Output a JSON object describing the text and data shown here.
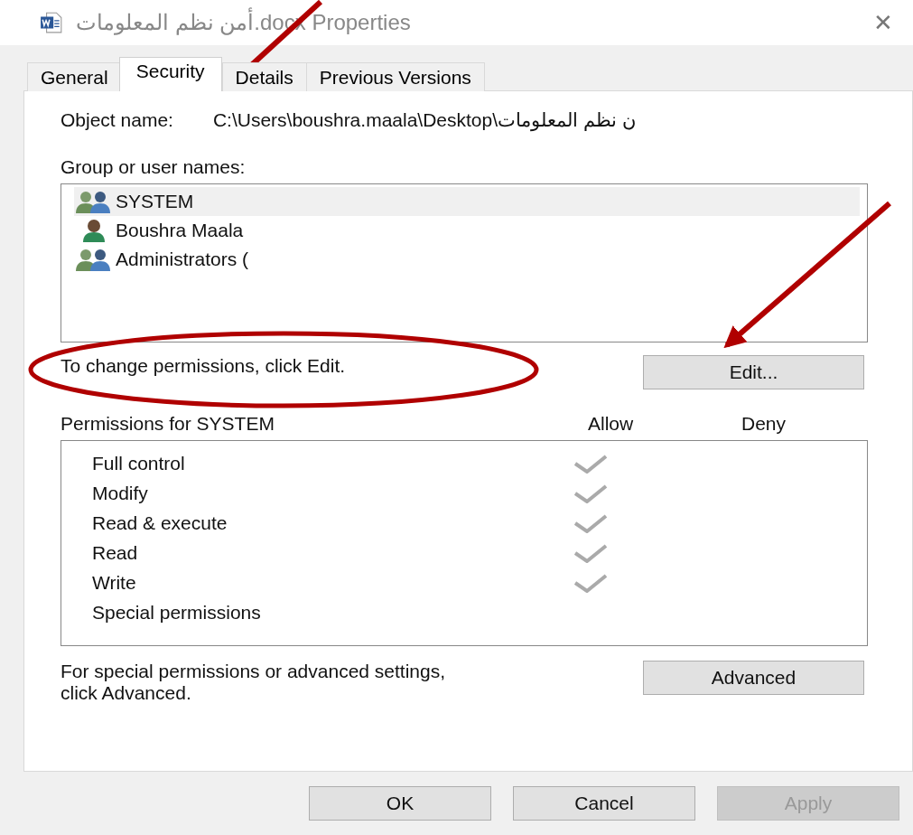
{
  "window": {
    "title": "أمن نظم المعلومات.docx Properties",
    "close": "✕"
  },
  "tabs": [
    {
      "label": "General",
      "selected": false
    },
    {
      "label": "Security",
      "selected": true
    },
    {
      "label": "Details",
      "selected": false
    },
    {
      "label": "Previous Versions",
      "selected": false
    }
  ],
  "object_name": {
    "label": "Object name:",
    "value": "C:\\Users\\boushra.maala\\Desktop\\ن نظم المعلومات"
  },
  "users": {
    "label": "Group or user names:",
    "items": [
      {
        "name": "SYSTEM",
        "kind": "group",
        "selected": true
      },
      {
        "name": "Boushra Maala",
        "kind": "user",
        "selected": false
      },
      {
        "name": "Administrators (",
        "kind": "group",
        "selected": false
      }
    ]
  },
  "change_hint": "To change permissions, click Edit.",
  "edit_button": "Edit...",
  "permissions": {
    "label": "Permissions for SYSTEM",
    "allow_label": "Allow",
    "deny_label": "Deny",
    "items": [
      {
        "name": "Full control",
        "allow": true,
        "deny": false
      },
      {
        "name": "Modify",
        "allow": true,
        "deny": false
      },
      {
        "name": "Read & execute",
        "allow": true,
        "deny": false
      },
      {
        "name": "Read",
        "allow": true,
        "deny": false
      },
      {
        "name": "Write",
        "allow": true,
        "deny": false
      },
      {
        "name": "Special permissions",
        "allow": false,
        "deny": false
      }
    ]
  },
  "advanced_hint": "For special permissions or advanced settings, click Advanced.",
  "advanced_button": "Advanced",
  "buttons": [
    {
      "label": "OK",
      "disabled": false
    },
    {
      "label": "Cancel",
      "disabled": false
    },
    {
      "label": "Apply",
      "disabled": true
    }
  ]
}
